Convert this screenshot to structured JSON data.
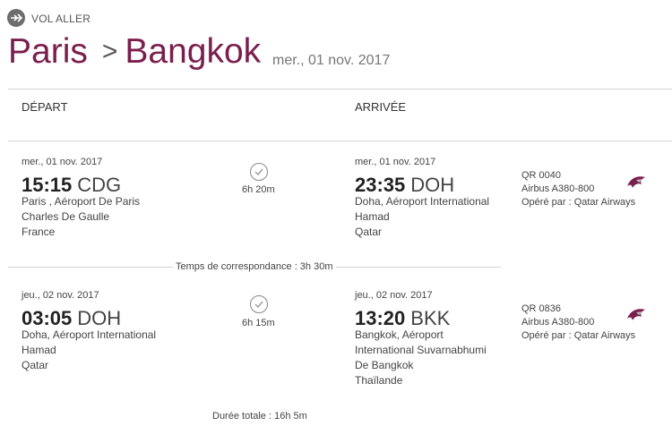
{
  "header": {
    "vol_label": "VOL ALLER",
    "origin": "Paris",
    "arrow": ">",
    "destination": "Bangkok",
    "date": "mer., 01 nov. 2017",
    "accent_color": "#7a1e4e"
  },
  "columns": {
    "depart": "DÉPART",
    "arrivee": "ARRIVÉE"
  },
  "segments": [
    {
      "dep": {
        "date": "mer., 01 nov. 2017",
        "time": "15:15",
        "code": "CDG",
        "lines": [
          "Paris , Aéroport De Paris",
          "Charles De Gaulle",
          "France"
        ]
      },
      "duration": "6h 20m",
      "arr": {
        "date": "mer., 01 nov. 2017",
        "time": "23:35",
        "code": "DOH",
        "lines": [
          "Doha, Aéroport International",
          "Hamad",
          "Qatar"
        ]
      },
      "flight": {
        "number": "QR 0040",
        "aircraft": "Airbus A380-800",
        "operator_prefix": "Opéré par : ",
        "operator": "Qatar Airways"
      },
      "icons": {
        "clock": "clock-icon",
        "logo": "qatar-airways-logo-icon"
      }
    },
    {
      "dep": {
        "date": "jeu., 02 nov. 2017",
        "time": "03:05",
        "code": "DOH",
        "lines": [
          "Doha, Aéroport International",
          "Hamad",
          "Qatar"
        ]
      },
      "duration": "6h 15m",
      "arr": {
        "date": "jeu., 02 nov. 2017",
        "time": "13:20",
        "code": "BKK",
        "lines": [
          "Bangkok, Aéroport",
          "International Suvarnabhumi",
          "De Bangkok",
          "Thaïlande"
        ]
      },
      "flight": {
        "number": "QR 0836",
        "aircraft": "Airbus A380-800",
        "operator_prefix": "Opéré par : ",
        "operator": "Qatar Airways"
      },
      "icons": {
        "clock": "clock-icon",
        "logo": "qatar-airways-logo-icon"
      }
    }
  ],
  "connection": "Temps de correspondance : 3h 30m",
  "total": "Durée totale : 16h 5m"
}
